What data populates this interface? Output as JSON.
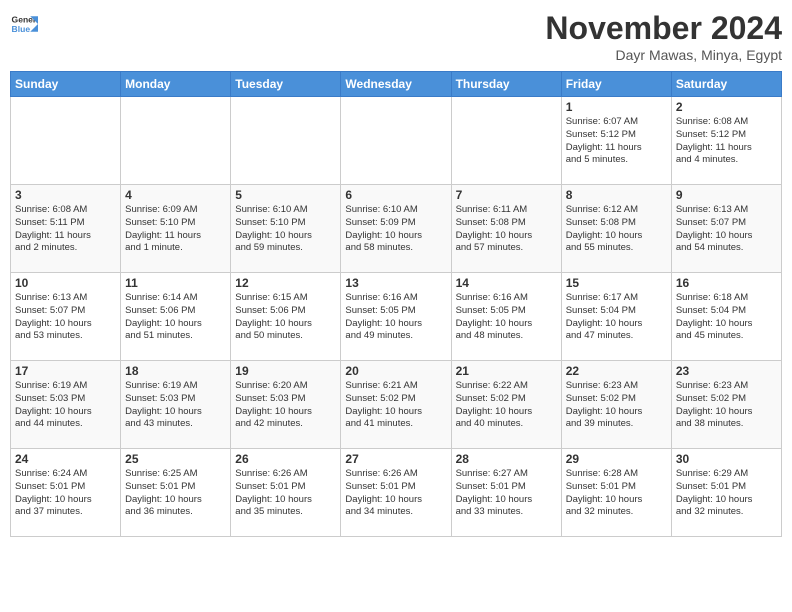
{
  "header": {
    "logo_line1": "General",
    "logo_line2": "Blue",
    "month_title": "November 2024",
    "subtitle": "Dayr Mawas, Minya, Egypt"
  },
  "weekdays": [
    "Sunday",
    "Monday",
    "Tuesday",
    "Wednesday",
    "Thursday",
    "Friday",
    "Saturday"
  ],
  "weeks": [
    [
      {
        "day": "",
        "info": ""
      },
      {
        "day": "",
        "info": ""
      },
      {
        "day": "",
        "info": ""
      },
      {
        "day": "",
        "info": ""
      },
      {
        "day": "",
        "info": ""
      },
      {
        "day": "1",
        "info": "Sunrise: 6:07 AM\nSunset: 5:12 PM\nDaylight: 11 hours\nand 5 minutes."
      },
      {
        "day": "2",
        "info": "Sunrise: 6:08 AM\nSunset: 5:12 PM\nDaylight: 11 hours\nand 4 minutes."
      }
    ],
    [
      {
        "day": "3",
        "info": "Sunrise: 6:08 AM\nSunset: 5:11 PM\nDaylight: 11 hours\nand 2 minutes."
      },
      {
        "day": "4",
        "info": "Sunrise: 6:09 AM\nSunset: 5:10 PM\nDaylight: 11 hours\nand 1 minute."
      },
      {
        "day": "5",
        "info": "Sunrise: 6:10 AM\nSunset: 5:10 PM\nDaylight: 10 hours\nand 59 minutes."
      },
      {
        "day": "6",
        "info": "Sunrise: 6:10 AM\nSunset: 5:09 PM\nDaylight: 10 hours\nand 58 minutes."
      },
      {
        "day": "7",
        "info": "Sunrise: 6:11 AM\nSunset: 5:08 PM\nDaylight: 10 hours\nand 57 minutes."
      },
      {
        "day": "8",
        "info": "Sunrise: 6:12 AM\nSunset: 5:08 PM\nDaylight: 10 hours\nand 55 minutes."
      },
      {
        "day": "9",
        "info": "Sunrise: 6:13 AM\nSunset: 5:07 PM\nDaylight: 10 hours\nand 54 minutes."
      }
    ],
    [
      {
        "day": "10",
        "info": "Sunrise: 6:13 AM\nSunset: 5:07 PM\nDaylight: 10 hours\nand 53 minutes."
      },
      {
        "day": "11",
        "info": "Sunrise: 6:14 AM\nSunset: 5:06 PM\nDaylight: 10 hours\nand 51 minutes."
      },
      {
        "day": "12",
        "info": "Sunrise: 6:15 AM\nSunset: 5:06 PM\nDaylight: 10 hours\nand 50 minutes."
      },
      {
        "day": "13",
        "info": "Sunrise: 6:16 AM\nSunset: 5:05 PM\nDaylight: 10 hours\nand 49 minutes."
      },
      {
        "day": "14",
        "info": "Sunrise: 6:16 AM\nSunset: 5:05 PM\nDaylight: 10 hours\nand 48 minutes."
      },
      {
        "day": "15",
        "info": "Sunrise: 6:17 AM\nSunset: 5:04 PM\nDaylight: 10 hours\nand 47 minutes."
      },
      {
        "day": "16",
        "info": "Sunrise: 6:18 AM\nSunset: 5:04 PM\nDaylight: 10 hours\nand 45 minutes."
      }
    ],
    [
      {
        "day": "17",
        "info": "Sunrise: 6:19 AM\nSunset: 5:03 PM\nDaylight: 10 hours\nand 44 minutes."
      },
      {
        "day": "18",
        "info": "Sunrise: 6:19 AM\nSunset: 5:03 PM\nDaylight: 10 hours\nand 43 minutes."
      },
      {
        "day": "19",
        "info": "Sunrise: 6:20 AM\nSunset: 5:03 PM\nDaylight: 10 hours\nand 42 minutes."
      },
      {
        "day": "20",
        "info": "Sunrise: 6:21 AM\nSunset: 5:02 PM\nDaylight: 10 hours\nand 41 minutes."
      },
      {
        "day": "21",
        "info": "Sunrise: 6:22 AM\nSunset: 5:02 PM\nDaylight: 10 hours\nand 40 minutes."
      },
      {
        "day": "22",
        "info": "Sunrise: 6:23 AM\nSunset: 5:02 PM\nDaylight: 10 hours\nand 39 minutes."
      },
      {
        "day": "23",
        "info": "Sunrise: 6:23 AM\nSunset: 5:02 PM\nDaylight: 10 hours\nand 38 minutes."
      }
    ],
    [
      {
        "day": "24",
        "info": "Sunrise: 6:24 AM\nSunset: 5:01 PM\nDaylight: 10 hours\nand 37 minutes."
      },
      {
        "day": "25",
        "info": "Sunrise: 6:25 AM\nSunset: 5:01 PM\nDaylight: 10 hours\nand 36 minutes."
      },
      {
        "day": "26",
        "info": "Sunrise: 6:26 AM\nSunset: 5:01 PM\nDaylight: 10 hours\nand 35 minutes."
      },
      {
        "day": "27",
        "info": "Sunrise: 6:26 AM\nSunset: 5:01 PM\nDaylight: 10 hours\nand 34 minutes."
      },
      {
        "day": "28",
        "info": "Sunrise: 6:27 AM\nSunset: 5:01 PM\nDaylight: 10 hours\nand 33 minutes."
      },
      {
        "day": "29",
        "info": "Sunrise: 6:28 AM\nSunset: 5:01 PM\nDaylight: 10 hours\nand 32 minutes."
      },
      {
        "day": "30",
        "info": "Sunrise: 6:29 AM\nSunset: 5:01 PM\nDaylight: 10 hours\nand 32 minutes."
      }
    ]
  ]
}
